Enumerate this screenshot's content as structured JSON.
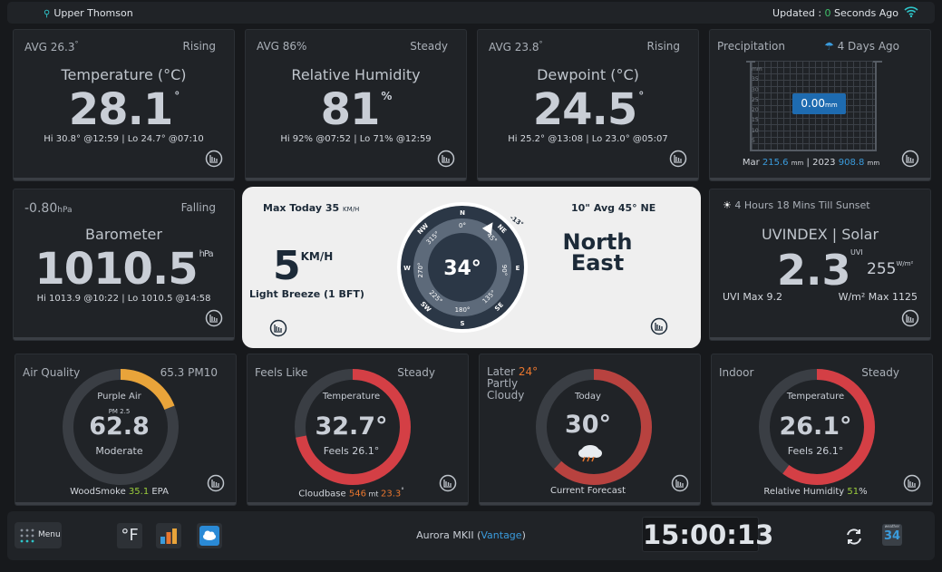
{
  "header": {
    "location": "Upper Thomson",
    "updated_prefix": "Updated : ",
    "updated_value": "0",
    "updated_suffix": " Seconds Ago"
  },
  "temperature": {
    "avg": "AVG 26.3",
    "avg_unit": "°",
    "trend": "Rising",
    "title": "Temperature (°C)",
    "value": "28.1",
    "unit": "°",
    "hilo": "Hi 30.8° @12:59 | Lo 24.7° @07:10"
  },
  "humidity": {
    "avg": "AVG 86",
    "avg_unit": "%",
    "trend": "Steady",
    "title": "Relative Humidity",
    "value": "81",
    "unit": "%",
    "hilo": "Hi 92% @07:52 | Lo 71% @12:59"
  },
  "dewpoint": {
    "avg": "AVG 23.8",
    "avg_unit": "°",
    "trend": "Rising",
    "title": "Dewpoint (°C)",
    "value": "24.5",
    "unit": "°",
    "hilo": "Hi 25.2° @13:08 | Lo 23.0° @05:07"
  },
  "precipitation": {
    "title": "Precipitation",
    "ago": "4 Days Ago",
    "value": "0.00",
    "unit": "mm",
    "scale": [
      "mm",
      "35",
      "30",
      "25",
      "20",
      "15",
      "10",
      "5"
    ],
    "month_label": "Mar",
    "month_value": "215.6",
    "month_unit": "mm",
    "year_label": "2023",
    "year_value": "908.8",
    "year_unit": "mm"
  },
  "barometer": {
    "change": "-0.80",
    "change_unit": "hPa",
    "trend": "Falling",
    "title": "Barometer",
    "value": "1010.5",
    "unit": "hPa",
    "hilo": "Hi 1013.9 @10:22 | Lo 1010.5 @14:58"
  },
  "wind": {
    "max_label": "Max Today 35",
    "max_unit": "KM/H",
    "speed": "5",
    "speed_unit": "KM/H",
    "desc": "Light Breeze (1 BFT)",
    "avg": "10\" Avg 45° NE",
    "dir_line1": "North",
    "dir_line2": "East",
    "bearing": "34°",
    "bearing_value": 34,
    "compass": {
      "N": "N",
      "NE": "NE",
      "E": "E",
      "SE": "SE",
      "S": "S",
      "SW": "SW",
      "W": "W",
      "NW": "NW"
    },
    "degrees": {
      "d0": "0°",
      "d45": "45°",
      "d90": "90°",
      "d135": "135°",
      "d180": "180°",
      "d225": "225°",
      "d270": "270°",
      "d315": "315°"
    },
    "marker": "-13°"
  },
  "uv": {
    "sunset": "4 Hours 18 Mins Till Sunset",
    "title": "UVINDEX | Solar",
    "value": "2.3",
    "uvi_unit": "UVI",
    "solar": "255",
    "solar_unit": "W/m²",
    "uvmax": "UVI Max 9.2",
    "solarmax": "W/m² Max 1125"
  },
  "airquality": {
    "title": "Air Quality",
    "pm10": "65.3 PM10",
    "label": "Purple Air",
    "sub": "PM 2.5",
    "value": "62.8",
    "status": "Moderate",
    "foot_pre": "WoodSmoke ",
    "foot_val": "35.1",
    "foot_post": " EPA",
    "fraction": 0.19,
    "color": "#e9a43a"
  },
  "feelslike": {
    "title": "Feels Like",
    "trend": "Steady",
    "label": "Temperature",
    "value": "32.7°",
    "sub": "Feels 26.1°",
    "foot_pre": "Cloudbase ",
    "foot_val": "546",
    "foot_mid": " mt ",
    "foot_val2": "23.3",
    "foot_sup": "°",
    "fraction": 0.72,
    "color": "#d43f45"
  },
  "forecast": {
    "title_pre": "Later ",
    "title_val": "24°",
    "title_l2": "Partly",
    "title_l3": "Cloudy",
    "label": "Today",
    "value": "30°",
    "foot": "Current Forecast",
    "fraction": 0.62,
    "color": "#b8423f"
  },
  "indoor": {
    "title": "Indoor",
    "trend": "Steady",
    "label": "Temperature",
    "value": "26.1°",
    "sub": "Feels 26.1°",
    "foot_pre": "Relative Humidity ",
    "foot_val": "51",
    "foot_post": "%",
    "fraction": 0.6,
    "color": "#d43f45"
  },
  "bottom": {
    "menu": "Menu",
    "units": "°F",
    "station_pre": "Aurora MKII (",
    "station_v": "Vantage",
    "station_post": ")",
    "time": "15:00:13",
    "cal_month": "weather",
    "cal_day": "34"
  }
}
